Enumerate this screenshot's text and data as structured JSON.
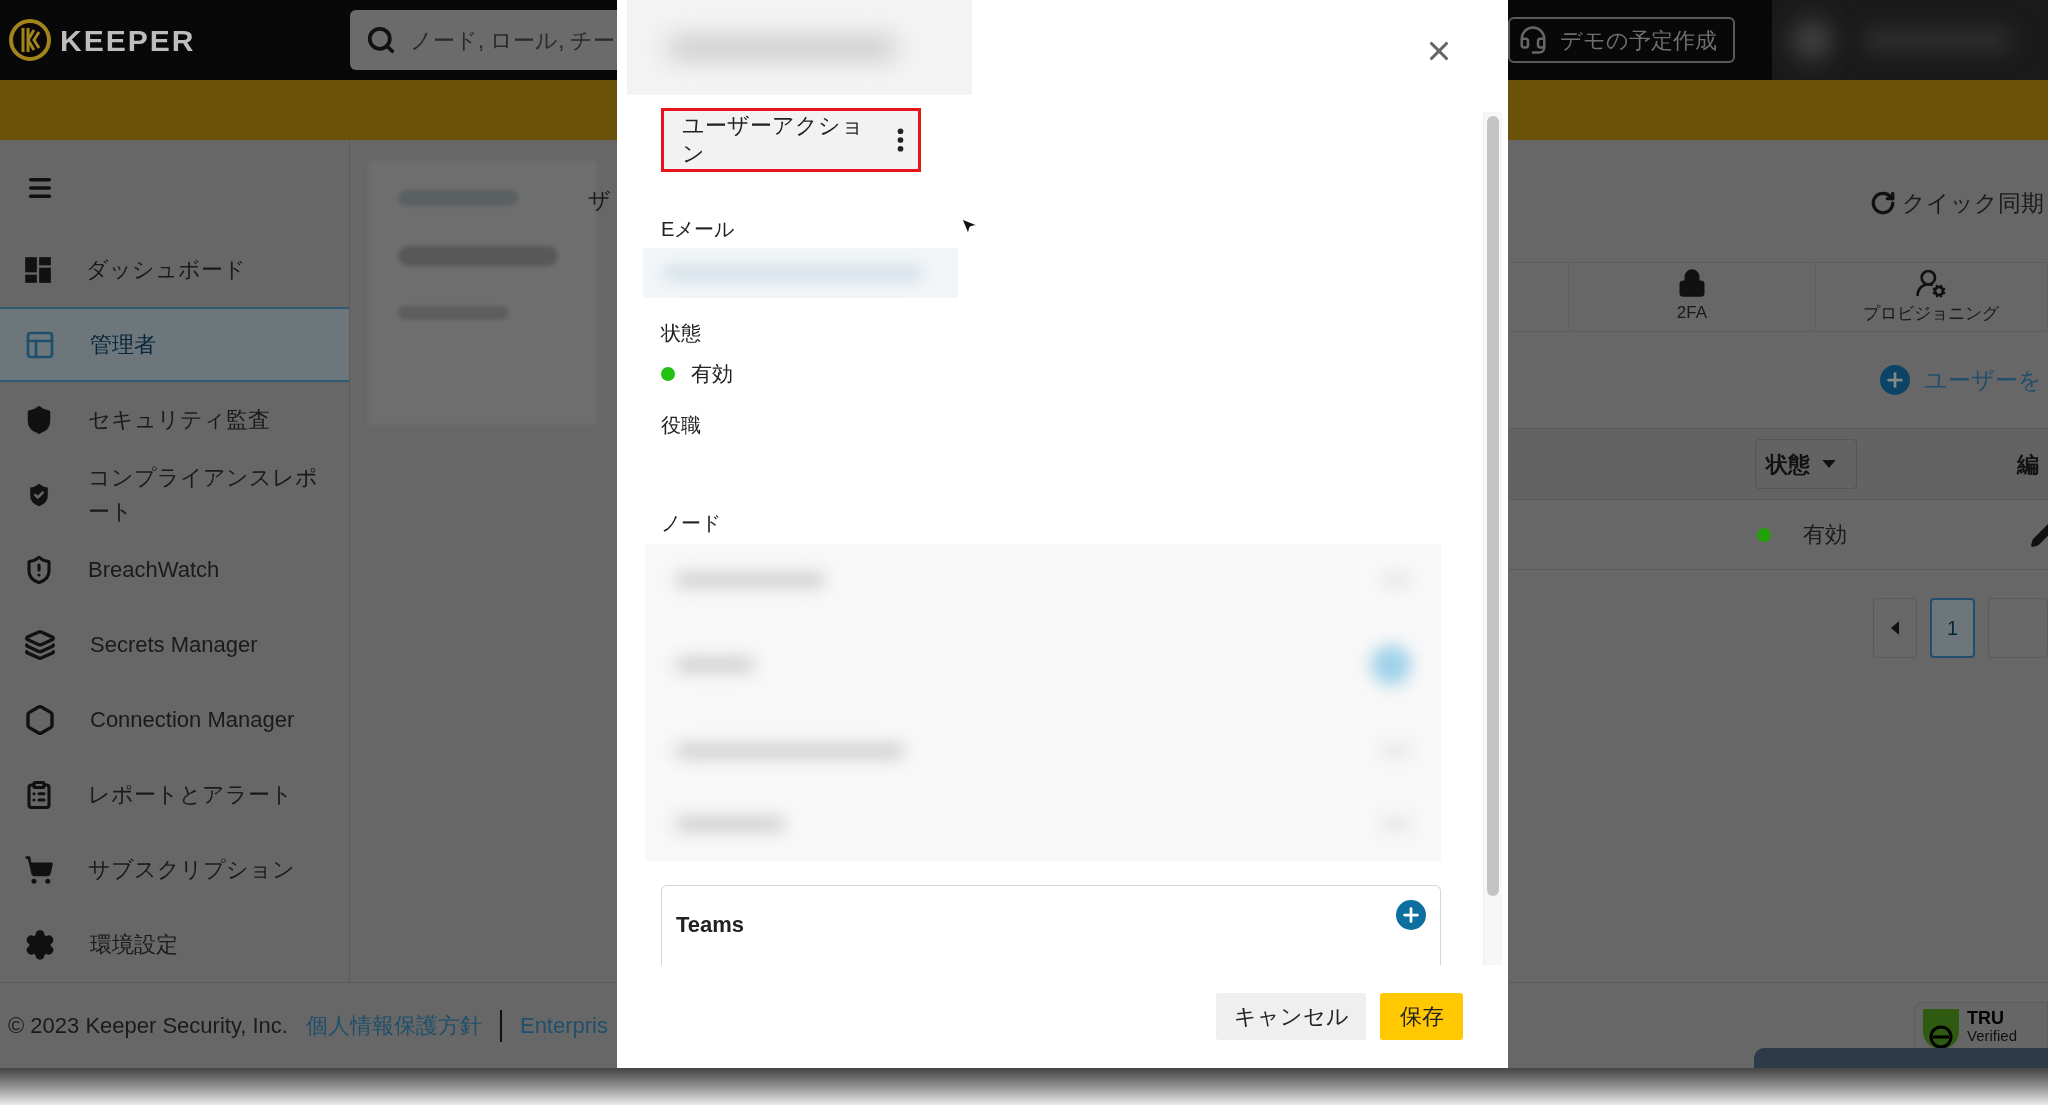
{
  "header": {
    "logo_text": "KEEPER",
    "search": {
      "placeholder": "ノード, ロール, チー"
    },
    "demo_button": "デモの予定作成"
  },
  "sidebar": {
    "items": [
      {
        "label": "ダッシュボード",
        "selected": false
      },
      {
        "label": "管理者",
        "selected": true
      },
      {
        "label": "セキュリティ監査",
        "selected": false
      },
      {
        "label": "コンプライアンスレポート",
        "selected": false
      },
      {
        "label": "BreachWatch",
        "selected": false
      },
      {
        "label": "Secrets Manager",
        "selected": false
      },
      {
        "label": "Connection Manager",
        "selected": false
      },
      {
        "label": "レポートとアラート",
        "selected": false
      },
      {
        "label": "サブスクリプション",
        "selected": false
      },
      {
        "label": "環境設定",
        "selected": false
      }
    ]
  },
  "main": {
    "breadcrumb_fragment": "ザ",
    "quick_sync": "クイック同期",
    "tabs": [
      {
        "label": "2FA"
      },
      {
        "label": "プロビジョニング"
      }
    ],
    "add_user": "ユーザーを",
    "table": {
      "columns": [
        {
          "label": "状態"
        },
        {
          "label": "編"
        }
      ],
      "rows": [
        {
          "status": "有効",
          "color": "#22a10a"
        }
      ]
    },
    "pagination": [
      {
        "label": "1",
        "selected": true
      }
    ]
  },
  "footer": {
    "copyright": "© 2023 Keeper Security, Inc.",
    "links": [
      "個人情報保護方針",
      "Enterpris"
    ],
    "badge": {
      "title": "TRU",
      "subtitle": "Verified"
    }
  },
  "modal": {
    "user_action_button": "ユーザーアクション",
    "fields": [
      {
        "kind": "blurred",
        "label": "Eメール"
      },
      {
        "kind": "status",
        "label": "状態",
        "value": "有効",
        "color": "#22c010"
      },
      {
        "kind": "empty",
        "label": "役職"
      },
      {
        "kind": "list",
        "label": "ノード"
      }
    ],
    "teams": {
      "label": "Teams"
    },
    "buttons": [
      {
        "label": "キャンセル",
        "kind": "secondary"
      },
      {
        "label": "保存",
        "kind": "primary"
      }
    ]
  }
}
